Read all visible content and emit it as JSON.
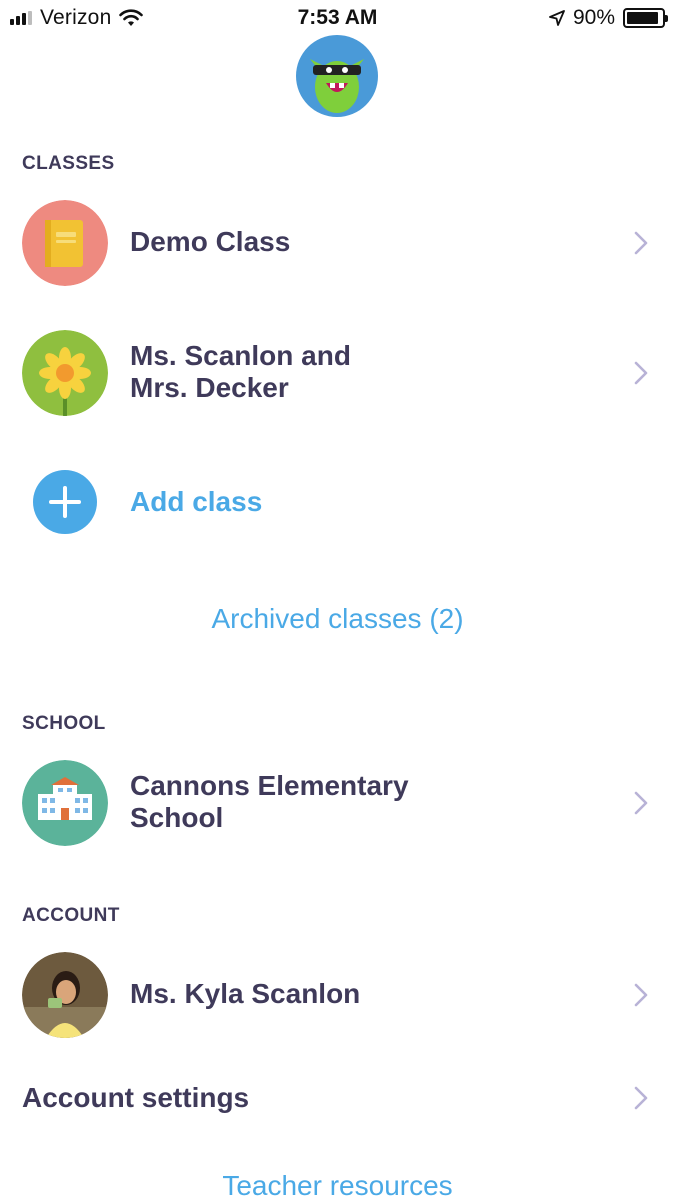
{
  "status_bar": {
    "carrier": "Verizon",
    "time": "7:53 AM",
    "battery_percent": "90%",
    "battery_level": 0.9
  },
  "classes": {
    "title": "CLASSES",
    "items": [
      {
        "label": "Demo Class",
        "icon": "notebook-icon",
        "color": "#ee8a80"
      },
      {
        "label_line1": "Ms. Scanlon and",
        "label_line2": "Mrs. Decker",
        "icon": "flower-icon",
        "color": "#8fbf3f"
      }
    ],
    "add_label": "Add class",
    "archived_label": "Archived classes (2)"
  },
  "school": {
    "title": "SCHOOL",
    "name_line1": "Cannons Elementary",
    "name_line2": "School",
    "icon": "school-building-icon",
    "color": "#5bb39a"
  },
  "account": {
    "title": "ACCOUNT",
    "name": "Ms. Kyla Scanlon",
    "settings_label": "Account settings",
    "resources_label": "Teacher resources"
  },
  "colors": {
    "text": "#3f3a5a",
    "accent": "#4aa9e6",
    "chevron": "#b8b2d6"
  }
}
